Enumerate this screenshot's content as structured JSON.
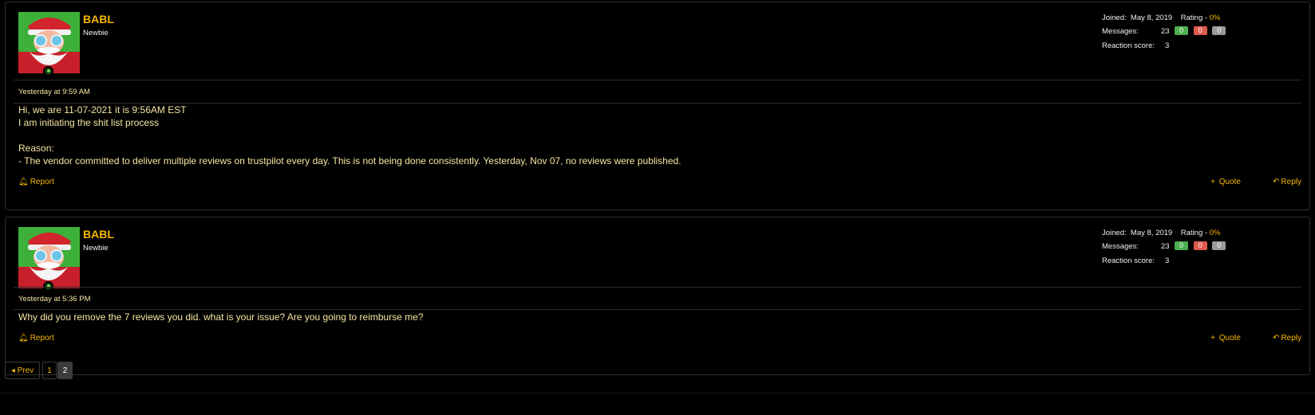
{
  "posts": [
    {
      "username": "BABL",
      "user_title": "Newbie",
      "joined_label": "Joined:",
      "joined_value": "May 8, 2019",
      "rating_label": "Rating -",
      "rating_value": "0%",
      "messages_label": "Messages:",
      "messages_value": "23",
      "badges": [
        "0",
        "0",
        "0"
      ],
      "reaction_label": "Reaction score:",
      "reaction_value": "3",
      "timestamp": "Yesterday at 9:59 AM",
      "body": [
        "Hi, we are 11-07-2021 it is 9:56AM EST",
        "I am initiating the shit list process",
        "",
        "Reason:",
        "- The vendor committed to deliver multiple reviews on trustpilot every day. This is not being done consistently. Yesterday, Nov 07, no reviews were published."
      ],
      "report_label": "Report",
      "quote_label": "Quote",
      "reply_label": "Reply"
    },
    {
      "username": "BABL",
      "user_title": "Newbie",
      "joined_label": "Joined:",
      "joined_value": "May 8, 2019",
      "rating_label": "Rating -",
      "rating_value": "0%",
      "messages_label": "Messages:",
      "messages_value": "23",
      "badges": [
        "0",
        "0",
        "0"
      ],
      "reaction_label": "Reaction score:",
      "reaction_value": "3",
      "timestamp": "Yesterday at 5:36 PM",
      "body": [
        "Why did you remove the 7 reviews you did. what is your issue? Are you going to reimburse me?"
      ],
      "report_label": "Report",
      "quote_label": "Quote",
      "reply_label": "Reply"
    }
  ],
  "pagination": {
    "prev_label": "Prev",
    "pages": [
      "1",
      "2"
    ],
    "current_page": "2"
  },
  "colors": {
    "accent": "#f5b800",
    "text_cream": "#f5e6a0",
    "badge_positive": "#4caf50",
    "badge_negative": "#e05a4e",
    "badge_neutral": "#9a9a9a"
  },
  "icons": {
    "report": "bell-icon",
    "quote": "plus-icon",
    "reply": "reply-arrow-icon",
    "prev": "caret-left-icon",
    "online": "online-status-icon"
  }
}
